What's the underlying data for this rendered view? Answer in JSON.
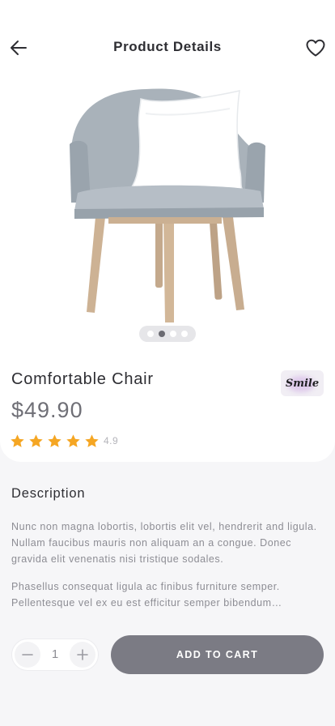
{
  "header": {
    "title": "Product Details",
    "back_icon": "arrow-left-icon",
    "favorite_icon": "heart-icon"
  },
  "product": {
    "name": "Comfortable Chair",
    "price": "$49.90",
    "rating": {
      "value": "4.9",
      "stars": 5
    },
    "brand": "Smile",
    "image_slides": 4,
    "active_slide": 2
  },
  "description": {
    "title": "Description",
    "paragraphs": [
      "Nunc non magna lobortis, lobortis elit vel, hendrerit and ligula. Nullam faucibus mauris non aliquam an a congue. Donec gravida elit venenatis nisi tristique sodales.",
      "Phasellus consequat ligula ac finibus furniture semper. Pellentesque vel ex eu est efficitur semper bibendum…"
    ]
  },
  "cart": {
    "quantity": "1",
    "add_label": "ADD TO CART",
    "minus_icon": "minus-icon",
    "plus_icon": "plus-icon"
  },
  "colors": {
    "accent_button": "#7b7b84",
    "star": "#f5a623",
    "background": "#f6f6f8",
    "card": "#ffffff"
  }
}
